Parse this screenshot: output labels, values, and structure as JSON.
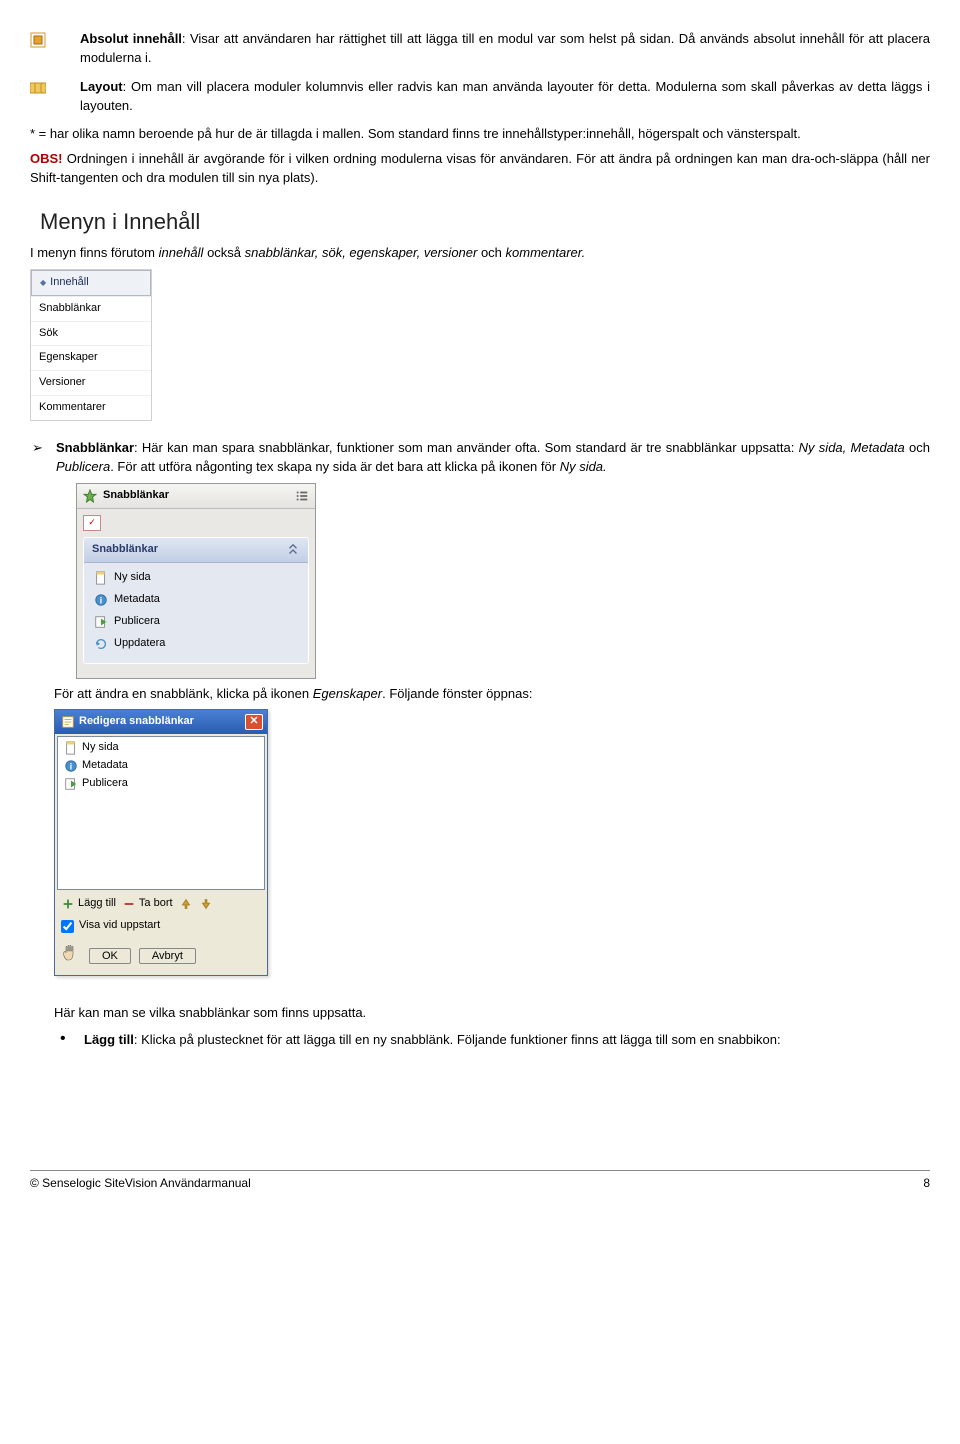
{
  "defs": {
    "absolut_title": "Absolut innehåll",
    "absolut_text": ": Visar att användaren har rättighet till att lägga till en modul var som helst på sidan. Då används absolut innehåll för att placera modulerna i.",
    "layout_title": "Layout",
    "layout_text": ": Om man vill placera moduler kolumnvis eller radvis kan man använda layouter för detta. Modulerna som skall påverkas av detta läggs i layouten."
  },
  "note_star": "* = har olika namn beroende på hur de är tillagda i mallen. Som standard finns tre innehållstyper:innehåll, högerspalt och vänsterspalt.",
  "obs_label": "OBS!",
  "obs_text": " Ordningen i innehåll är avgörande för i vilken ordning modulerna visas för användaren. För att ändra på ordningen kan man dra-och-släppa (håll ner Shift-tangenten och dra modulen till sin nya plats).",
  "section_title": "Menyn i Innehåll",
  "section_intro_a": "I menyn finns förutom ",
  "section_intro_b": "innehåll",
  "section_intro_c": " också ",
  "section_intro_d": "snabblänkar, sök, egenskaper, versioner",
  "section_intro_e": " och ",
  "section_intro_f": "kommentarer.",
  "menu": {
    "items": [
      "Innehåll",
      "Snabblänkar",
      "Sök",
      "Egenskaper",
      "Versioner",
      "Kommentarer"
    ]
  },
  "snabb_bullet": {
    "title": "Snabblänkar",
    "text_a": ": Här kan man spara snabblänkar, funktioner som man använder ofta. Som standard  är tre snabblänkar uppsatta: ",
    "text_b": "Ny sida, Metadata",
    "text_c": " och ",
    "text_d": "Publicera",
    "text_e": ". För att utföra någonting tex skapa ny sida är det bara att klicka på ikonen för ",
    "text_f": "Ny sida."
  },
  "sb_panel": {
    "title": "Snabblänkar",
    "inner_title": "Snabblänkar",
    "items": [
      "Ny sida",
      "Metadata",
      "Publicera",
      "Uppdatera"
    ]
  },
  "after_panel_a": "För att ändra en snabblänk, klicka på ikonen ",
  "after_panel_b": "Egenskaper",
  "after_panel_c": ". Följande fönster öppnas:",
  "dlg": {
    "title": "Redigera snabblänkar",
    "items": [
      "Ny sida",
      "Metadata",
      "Publicera"
    ],
    "add": "Lägg till",
    "remove": "Ta bort",
    "show_on_start": "Visa vid uppstart",
    "ok": "OK",
    "cancel": "Avbryt"
  },
  "after_dlg": "Här kan man se vilka snabblänkar som finns uppsatta.",
  "lagg_bullet": {
    "title": "Lägg till",
    "text": ": Klicka på plustecknet för att lägga till en ny snabblänk. Följande funktioner finns att lägga till som en snabbikon:"
  },
  "footer": {
    "left": "© Senselogic SiteVision Användarmanual",
    "right": "8"
  }
}
